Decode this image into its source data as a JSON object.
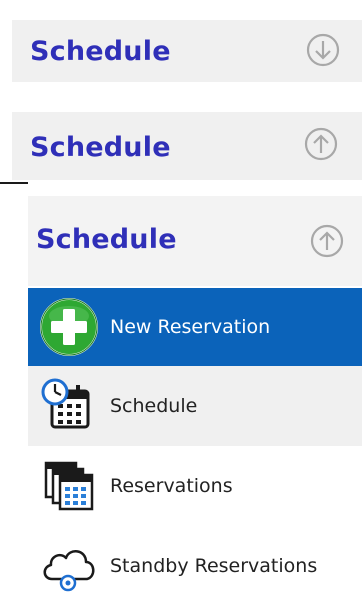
{
  "panels": [
    {
      "title": "Schedule",
      "toggle_icon": "arrow-down-circle-icon",
      "state": "collapsed"
    },
    {
      "title": "Schedule",
      "toggle_icon": "arrow-up-circle-icon",
      "state": "expanded"
    },
    {
      "title": "Schedule",
      "toggle_icon": "arrow-up-circle-icon",
      "state": "expanded"
    }
  ],
  "menu": {
    "items": [
      {
        "label": "New Reservation",
        "icon": "plus-circle-icon",
        "selected": true
      },
      {
        "label": "Schedule",
        "icon": "calendar-clock-icon",
        "selected": false
      },
      {
        "label": "Reservations",
        "icon": "calendar-stack-icon",
        "selected": false
      },
      {
        "label": "Standby Reservations",
        "icon": "cloud-icon",
        "selected": false
      }
    ]
  },
  "colors": {
    "title": "#2f2fb8",
    "selected_background": "#0b63ba",
    "panel_background": "#f0f0f0",
    "plus_green": "#2ea832"
  }
}
